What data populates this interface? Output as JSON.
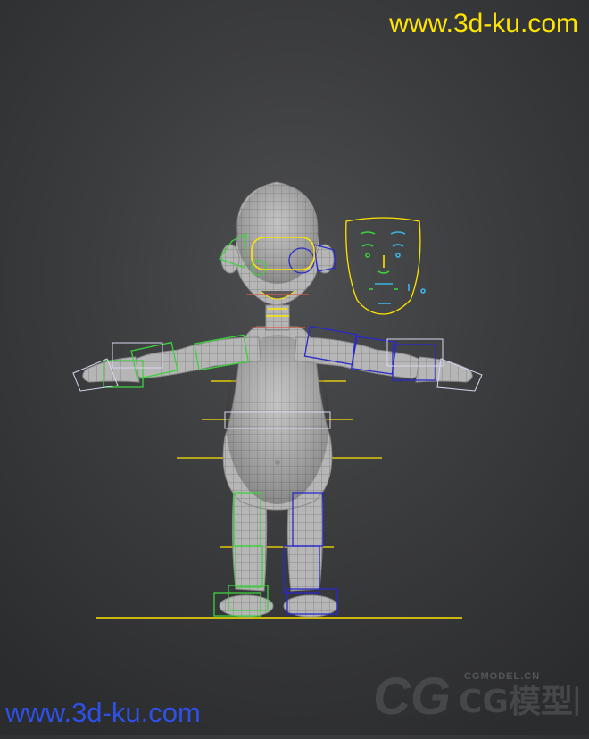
{
  "watermarks": {
    "top": "www.3d-ku.com",
    "bottom": "www.3d-ku.com",
    "logo_sub": "CGMODEL.CN",
    "logo_main": "CG模型网"
  },
  "colors": {
    "background": "#3c3d3f",
    "watermark_top": "#ffe500",
    "watermark_bottom": "#2e50e6",
    "mesh_fill": "#b4b4b4",
    "wire": "#7c7c7c",
    "rig_green": "#3cd23c",
    "rig_blue": "#2a2ac8",
    "rig_yellow": "#ffe400",
    "rig_light": "#d8d8f0"
  },
  "scene": {
    "subject": "cartoon-character-rig-front-view",
    "face_gui": "facial-control-panel"
  }
}
